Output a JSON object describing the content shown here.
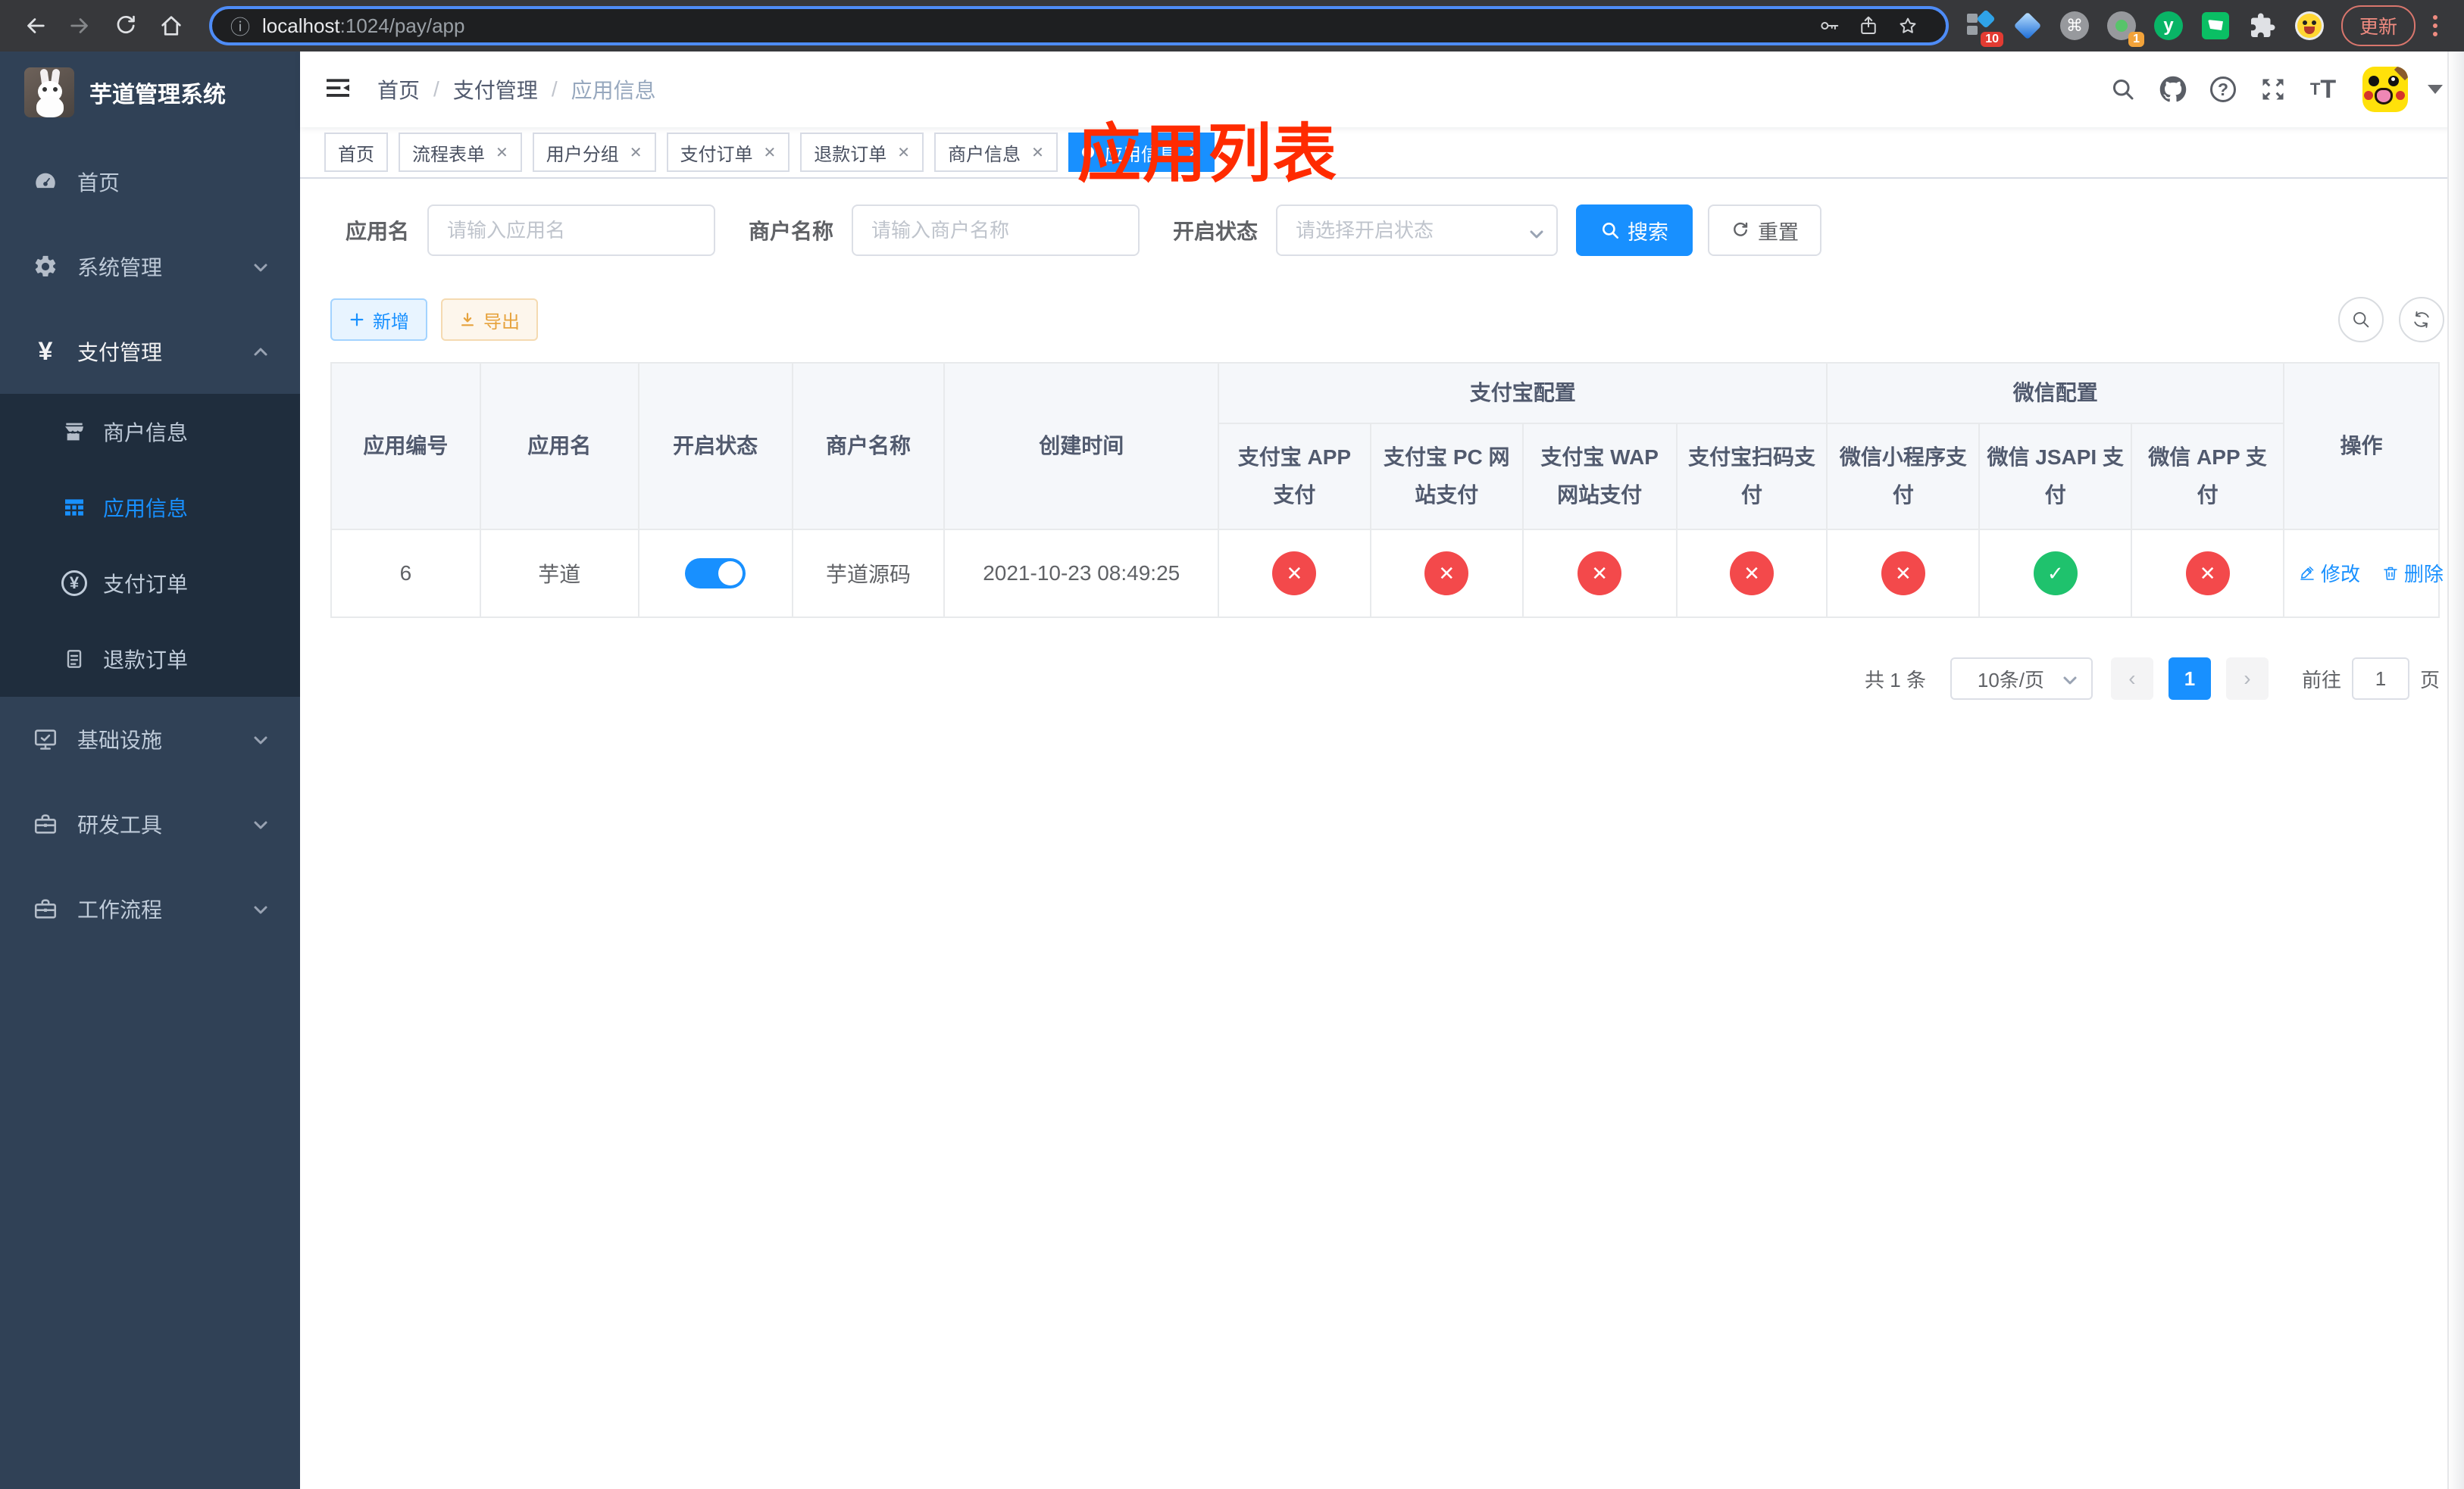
{
  "colors": {
    "primary": "#1890ff",
    "status_on": "#1fc26d",
    "status_off": "#f3494b",
    "annotation": "#ff2b00",
    "sidebar_bg": "#304156",
    "submenu_bg": "#1f2d3d"
  },
  "browser": {
    "url_host": "localhost",
    "url_path": ":1024/pay/app",
    "update_label": "更新",
    "ext_badge_blocks": "10",
    "ext_badge_circle": "1",
    "ext_letter": "y",
    "cmd_glyph": "⌘",
    "info_glyph": "ⓘ"
  },
  "sidebar": {
    "title": "芋道管理系统",
    "items": [
      {
        "label": "首页"
      },
      {
        "label": "系统管理"
      },
      {
        "label": "支付管理"
      },
      {
        "label": "商户信息"
      },
      {
        "label": "应用信息"
      },
      {
        "label": "支付订单"
      },
      {
        "label": "退款订单"
      },
      {
        "label": "基础设施"
      },
      {
        "label": "研发工具"
      },
      {
        "label": "工作流程"
      }
    ]
  },
  "navbar": {
    "breadcrumb": {
      "home": "首页",
      "parent": "支付管理",
      "current": "应用信息"
    },
    "annotation": "应用列表",
    "help_glyph": "?"
  },
  "tags": {
    "items": [
      {
        "label": "首页"
      },
      {
        "label": "流程表单"
      },
      {
        "label": "用户分组"
      },
      {
        "label": "支付订单"
      },
      {
        "label": "退款订单"
      },
      {
        "label": "商户信息"
      },
      {
        "label": "应用信息"
      }
    ]
  },
  "filters": {
    "name_label": "应用名",
    "name_placeholder": "请输入应用名",
    "merchant_label": "商户名称",
    "merchant_placeholder": "请输入商户名称",
    "status_label": "开启状态",
    "status_placeholder": "请选择开启状态",
    "search_label": "搜索",
    "reset_label": "重置"
  },
  "toolbar": {
    "add_label": "新增",
    "export_label": "导出"
  },
  "table": {
    "columns": {
      "id": "应用编号",
      "name": "应用名",
      "status": "开启状态",
      "merchant": "商户名称",
      "created": "创建时间",
      "alipay_group": "支付宝配置",
      "wechat_group": "微信配置",
      "alipay_app": "支付宝 APP 支付",
      "alipay_pc": "支付宝 PC 网站支付",
      "alipay_wap": "支付宝 WAP 网站支付",
      "alipay_qr": "支付宝扫码支付",
      "wx_lite": "微信小程序支付",
      "wx_jsapi": "微信 JSAPI 支付",
      "wx_app": "微信 APP 支付",
      "actions": "操作"
    },
    "row": {
      "id": "6",
      "name": "芋道",
      "enabled": true,
      "merchant": "芋道源码",
      "created": "2021-10-23 08:49:25",
      "statuses": {
        "alipay_app": false,
        "alipay_pc": false,
        "alipay_wap": false,
        "alipay_qr": false,
        "wx_lite": false,
        "wx_jsapi": true,
        "wx_app": false
      },
      "edit_label": "修改",
      "delete_label": "删除"
    }
  },
  "pagination": {
    "total_label": "共 1 条",
    "page_size_label": "10条/页",
    "current_page": "1",
    "goto_label": "前往",
    "goto_value": "1",
    "page_unit": "页"
  }
}
